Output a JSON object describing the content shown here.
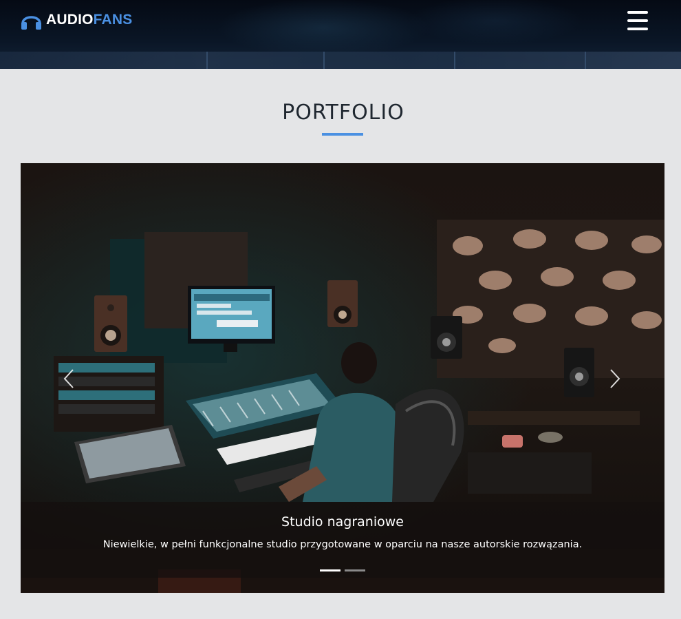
{
  "header": {
    "logo_part1": "AUDIO",
    "logo_part2": "FANS",
    "menu_icon": "hamburger-menu-icon"
  },
  "section": {
    "title": "PORTFOLIO"
  },
  "carousel": {
    "slides": [
      {
        "title": "Studio nagraniowe",
        "description": "Niewielkie, w pełni funkcjonalne studio przygotowane w oparciu na nasze autorskie rozwązania."
      }
    ],
    "slide_count": 2,
    "active_slide": 1,
    "prev_icon": "chevron-left-icon",
    "next_icon": "chevron-right-icon"
  },
  "colors": {
    "accent": "#4a90e2",
    "header_bg": "#0a1626",
    "page_bg": "#e4e5e7",
    "title_text": "#1f2730"
  }
}
